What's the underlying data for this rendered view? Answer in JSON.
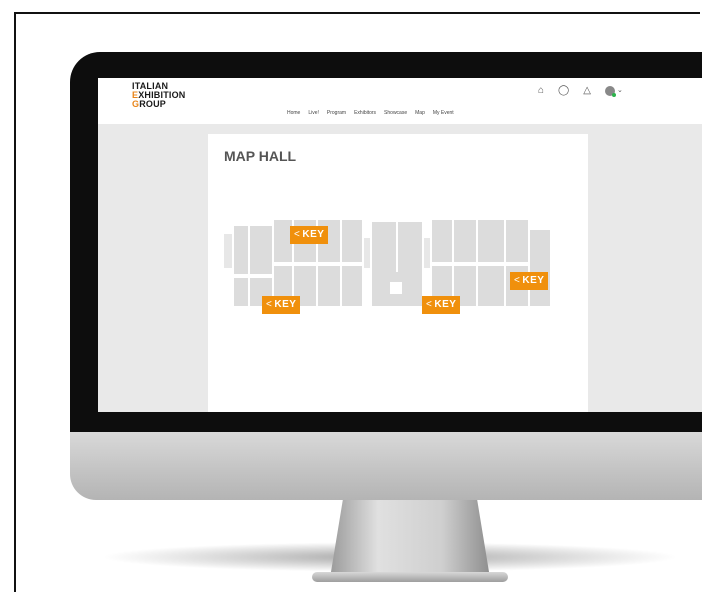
{
  "header": {
    "logo_line1": "ITALIAN",
    "logo_line2_accent": "E",
    "logo_line2_rest": "XHIBITION",
    "logo_line3_accent": "G",
    "logo_line3_rest": "ROUP",
    "nav": [
      "Home",
      "Live!",
      "Program",
      "Exhibitors",
      "Showcase",
      "Map",
      "My Event"
    ],
    "icons": [
      "home-icon",
      "chat-icon",
      "bell-icon",
      "avatar",
      "chevron-down-icon"
    ]
  },
  "main": {
    "title": "MAP HALL",
    "key_markers": [
      {
        "label": "KEY",
        "arrow": "<"
      },
      {
        "label": "KEY",
        "arrow": "<"
      },
      {
        "label": "KEY",
        "arrow": "<"
      },
      {
        "label": "KEY",
        "arrow": "<"
      }
    ]
  },
  "colors": {
    "accent": "#f0900c",
    "hall": "#dcdcdc",
    "screen_bg": "#e9e9e9",
    "bezel": "#0d0d0d"
  }
}
